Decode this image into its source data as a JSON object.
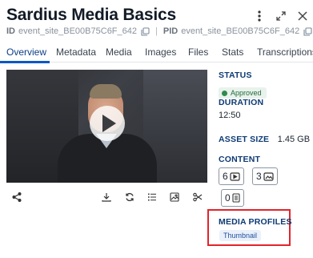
{
  "header": {
    "title": "Sardius Media Basics",
    "id_label": "ID",
    "id_value": "event_site_BE00B75C6F_642",
    "pid_label": "PID",
    "pid_value": "event_site_BE00B75C6F_642",
    "separator": "|"
  },
  "tabs": [
    "Overview",
    "Metadata",
    "Media",
    "Images",
    "Files",
    "Stats",
    "Transcriptions"
  ],
  "active_tab": "Overview",
  "video": {
    "state": "paused"
  },
  "side": {
    "status_label": "STATUS",
    "status_value": "Approved",
    "duration_label": "DURATION",
    "duration_value": "12:50",
    "asset_size_label": "ASSET SIZE",
    "asset_size_value": "1.45 GB",
    "content_label": "CONTENT",
    "content_video_count": "6",
    "content_image_count": "3",
    "content_doc_count": "0",
    "media_profiles_label": "MEDIA PROFILES",
    "media_profile_badge": "Thumbnail"
  },
  "colors": {
    "accent": "#0b57c6",
    "label": "#0d3a73",
    "approved": "#2e8b4a",
    "highlight": "#e3242b"
  }
}
